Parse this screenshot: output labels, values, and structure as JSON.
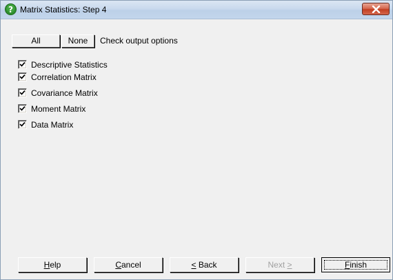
{
  "window": {
    "title": "Matrix Statistics: Step 4"
  },
  "toolbar": {
    "all_label": "All",
    "none_label": "None",
    "check_output_label": "Check output options"
  },
  "options": [
    {
      "label": "Descriptive Statistics",
      "checked": true
    },
    {
      "label": "Correlation Matrix",
      "checked": true
    },
    {
      "label": "Covariance Matrix",
      "checked": true
    },
    {
      "label": "Moment Matrix",
      "checked": true
    },
    {
      "label": "Data Matrix",
      "checked": true
    }
  ],
  "footer": {
    "help": {
      "accel": "H",
      "rest": "elp"
    },
    "cancel": {
      "accel": "C",
      "rest": "ancel"
    },
    "back": {
      "accel": "<",
      "rest": " Back"
    },
    "next": {
      "pre": "Next ",
      "accel": ">"
    },
    "finish": {
      "accel": "F",
      "rest": "inish"
    }
  },
  "colors": {
    "window_bg": "#f0f0f0",
    "title_icon": "#2f8f2f",
    "close_button": "#c94a30"
  },
  "icons": {
    "title": "question-help-icon",
    "close": "close-icon",
    "checkbox": "checkmark-icon"
  }
}
